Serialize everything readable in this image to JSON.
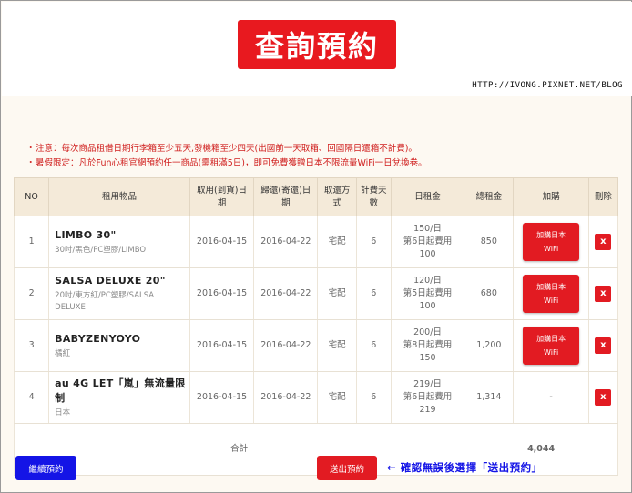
{
  "page": {
    "title": "查詢預約",
    "blog_url": "HTTP://IVONG.PIXNET.NET/BLOG"
  },
  "notes": [
    "注意：每次商品租借日期行李箱至少五天,發機箱至少四天(出國前一天取箱、回國隔日還箱不計費)。",
    "暑假限定：凡於Fun心租官網預約任一商品(需租滿5日)，即可免費獲贈日本不限流量WiFi一日兌換卷。"
  ],
  "note_bullet": "・",
  "table": {
    "headers": [
      "NO",
      "租用物品",
      "取用(到貨)日期",
      "歸還(寄還)日期",
      "取還方式",
      "計費天數",
      "日租金",
      "總租金",
      "加購",
      "刪除"
    ],
    "rows": [
      {
        "no": "1",
        "name": "LIMBO 30\"",
        "desc": "30吋/黑色/PC塑膠/LIMBO",
        "pickup": "2016-04-15",
        "return": "2016-04-22",
        "method": "宅配",
        "days": "6",
        "rate_line1": "150/日",
        "rate_line2": "第6日起費用",
        "rate_line3": "100",
        "total": "850",
        "addon_line1": "加購日本",
        "addon_line2": "WiFi",
        "delete": "x"
      },
      {
        "no": "2",
        "name": "SALSA DELUXE 20\"",
        "desc": "20吋/東方紅/PC塑膠/SALSA DELUXE",
        "pickup": "2016-04-15",
        "return": "2016-04-22",
        "method": "宅配",
        "days": "6",
        "rate_line1": "120/日",
        "rate_line2": "第5日起費用",
        "rate_line3": "100",
        "total": "680",
        "addon_line1": "加購日本",
        "addon_line2": "WiFi",
        "delete": "x"
      },
      {
        "no": "3",
        "name": "BABYZENYOYO",
        "desc": "橘紅",
        "pickup": "2016-04-15",
        "return": "2016-04-22",
        "method": "宅配",
        "days": "6",
        "rate_line1": "200/日",
        "rate_line2": "第8日起費用",
        "rate_line3": "150",
        "total": "1,200",
        "addon_line1": "加購日本",
        "addon_line2": "WiFi",
        "delete": "x"
      },
      {
        "no": "4",
        "name": "au 4G LET「嵐」無流量限制",
        "desc": "日本",
        "pickup": "2016-04-15",
        "return": "2016-04-22",
        "method": "宅配",
        "days": "6",
        "rate_line1": "219/日",
        "rate_line2": "第6日起費用",
        "rate_line3": "219",
        "total": "1,314",
        "addon_text": "-",
        "delete": "x"
      }
    ],
    "total_label": "合計",
    "total_value": "4,044"
  },
  "buttons": {
    "continue": "繼續預約",
    "submit": "送出預約"
  },
  "annotation": "← 確認無誤後選擇「送出預約」",
  "colors": {
    "accent_red": "#e21b22",
    "continue_blue": "#1414e6",
    "header_bg": "#f4ead9",
    "note_red": "#d0201f"
  }
}
